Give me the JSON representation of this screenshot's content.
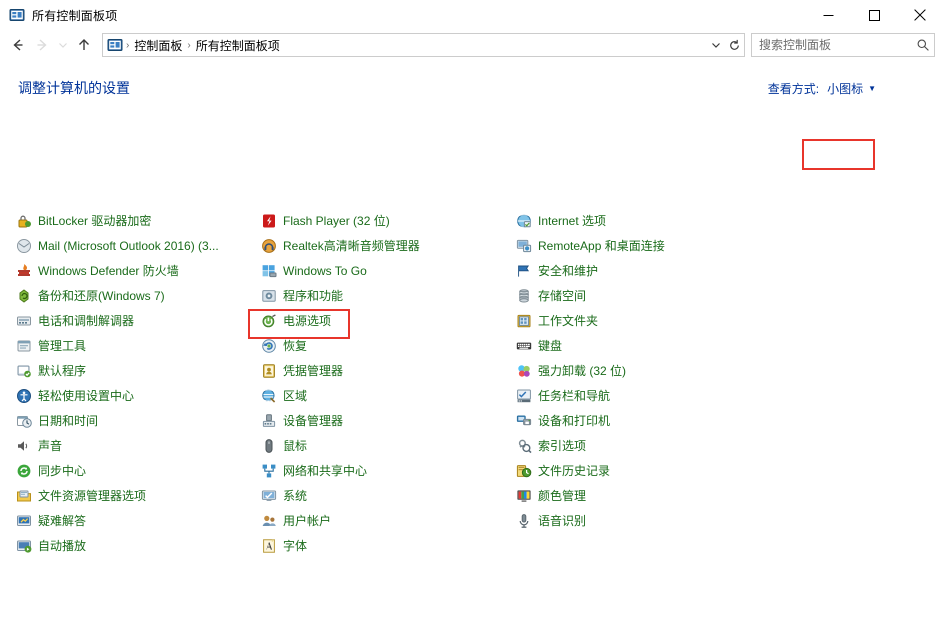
{
  "window": {
    "title": "所有控制面板项",
    "icon": "control-panel-icon",
    "buttons": {
      "minimize": "minimize-icon",
      "maximize": "maximize-icon",
      "close": "close-icon"
    }
  },
  "toolbar": {
    "back": "back-arrow-icon",
    "forward": "forward-arrow-icon",
    "recent": "chevron-down-icon",
    "up": "up-arrow-icon",
    "address": {
      "icon": "control-panel-icon",
      "crumbs": [
        "控制面板",
        "所有控制面板项"
      ],
      "separator": "›",
      "dropdown": "chevron-down-icon",
      "refresh": "refresh-icon"
    },
    "search": {
      "placeholder": "搜索控制面板",
      "value": "",
      "icon": "search-icon"
    }
  },
  "page": {
    "heading": "调整计算机的设置",
    "view_mode": {
      "label": "查看方式:",
      "value": "小图标",
      "caret": "▼"
    }
  },
  "highlight_color": "#e8352b",
  "columns": [
    {
      "items": [
        {
          "label": "BitLocker 驱动器加密",
          "icon": "bitlocker-icon"
        },
        {
          "label": "Mail (Microsoft Outlook 2016) (3...",
          "icon": "mail-icon"
        },
        {
          "label": "Windows Defender 防火墙",
          "icon": "firewall-icon"
        },
        {
          "label": "备份和还原(Windows 7)",
          "icon": "backup-restore-icon"
        },
        {
          "label": "电话和调制解调器",
          "icon": "phone-modem-icon"
        },
        {
          "label": "管理工具",
          "icon": "administrative-tools-icon"
        },
        {
          "label": "默认程序",
          "icon": "default-programs-icon"
        },
        {
          "label": "轻松使用设置中心",
          "icon": "ease-of-access-icon"
        },
        {
          "label": "日期和时间",
          "icon": "date-time-icon"
        },
        {
          "label": "声音",
          "icon": "sound-icon"
        },
        {
          "label": "同步中心",
          "icon": "sync-center-icon"
        },
        {
          "label": "文件资源管理器选项",
          "icon": "file-explorer-options-icon"
        },
        {
          "label": "疑难解答",
          "icon": "troubleshooting-icon"
        },
        {
          "label": "自动播放",
          "icon": "autoplay-icon"
        }
      ]
    },
    {
      "items": [
        {
          "label": "Flash Player (32 位)",
          "icon": "flash-player-icon"
        },
        {
          "label": "Realtek高清晰音频管理器",
          "icon": "realtek-audio-icon"
        },
        {
          "label": "Windows To Go",
          "icon": "windows-to-go-icon"
        },
        {
          "label": "程序和功能",
          "icon": "programs-features-icon"
        },
        {
          "label": "电源选项",
          "icon": "power-options-icon",
          "highlighted": true
        },
        {
          "label": "恢复",
          "icon": "recovery-icon"
        },
        {
          "label": "凭据管理器",
          "icon": "credential-manager-icon"
        },
        {
          "label": "区域",
          "icon": "region-icon"
        },
        {
          "label": "设备管理器",
          "icon": "device-manager-icon"
        },
        {
          "label": "鼠标",
          "icon": "mouse-icon"
        },
        {
          "label": "网络和共享中心",
          "icon": "network-sharing-icon"
        },
        {
          "label": "系统",
          "icon": "system-icon"
        },
        {
          "label": "用户帐户",
          "icon": "user-accounts-icon"
        },
        {
          "label": "字体",
          "icon": "fonts-icon"
        }
      ]
    },
    {
      "items": [
        {
          "label": "Internet 选项",
          "icon": "internet-options-icon"
        },
        {
          "label": "RemoteApp 和桌面连接",
          "icon": "remoteapp-icon"
        },
        {
          "label": "安全和维护",
          "icon": "security-maintenance-icon"
        },
        {
          "label": "存储空间",
          "icon": "storage-spaces-icon"
        },
        {
          "label": "工作文件夹",
          "icon": "work-folders-icon"
        },
        {
          "label": "键盘",
          "icon": "keyboard-icon"
        },
        {
          "label": "强力卸载 (32 位)",
          "icon": "uninstaller-icon"
        },
        {
          "label": "任务栏和导航",
          "icon": "taskbar-navigation-icon"
        },
        {
          "label": "设备和打印机",
          "icon": "devices-printers-icon"
        },
        {
          "label": "索引选项",
          "icon": "indexing-options-icon"
        },
        {
          "label": "文件历史记录",
          "icon": "file-history-icon"
        },
        {
          "label": "颜色管理",
          "icon": "color-management-icon"
        },
        {
          "label": "语音识别",
          "icon": "speech-recognition-icon"
        }
      ]
    }
  ]
}
